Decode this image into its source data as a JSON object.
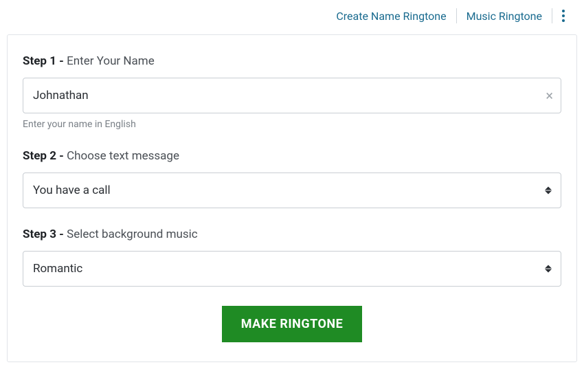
{
  "nav": {
    "link1": "Create Name Ringtone",
    "link2": "Music Ringtone"
  },
  "step1": {
    "prefix": "Step 1 - ",
    "label": "Enter Your Name",
    "value": "Johnathan",
    "hint": "Enter your name in English"
  },
  "step2": {
    "prefix": "Step 2 - ",
    "label": "Choose text message",
    "value": "You have a call"
  },
  "step3": {
    "prefix": "Step 3 - ",
    "label": "Select background music",
    "value": "Romantic"
  },
  "submit": {
    "label": "MAKE RINGTONE"
  }
}
